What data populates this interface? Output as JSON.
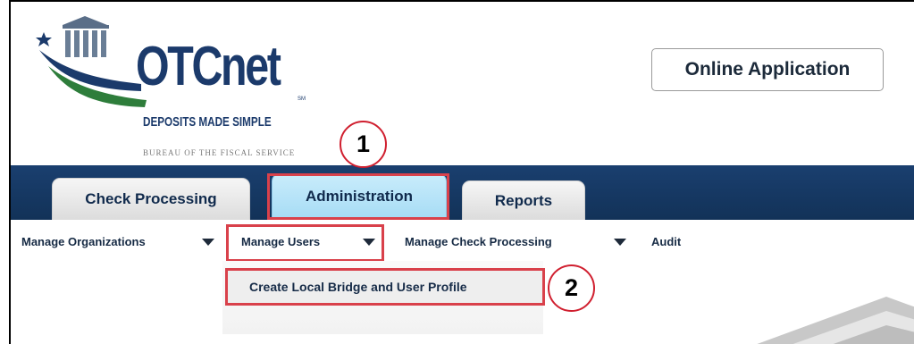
{
  "logo": {
    "name": "OTCnet",
    "sm_mark": "SM",
    "tagline": "DEPOSITS MADE SIMPLE",
    "bureau": "BUREAU OF THE FISCAL SERVICE"
  },
  "header": {
    "online_application_label": "Online Application"
  },
  "callouts": {
    "one": "1",
    "two": "2"
  },
  "tabs": [
    {
      "label": "Check Processing"
    },
    {
      "label": "Administration"
    },
    {
      "label": "Reports"
    }
  ],
  "submenu": {
    "items": [
      {
        "label": "Manage Organizations"
      },
      {
        "label": "Manage Users"
      },
      {
        "label": "Manage Check Processing"
      },
      {
        "label": "Audit"
      }
    ]
  },
  "dropdown": {
    "items": [
      {
        "label": "Create Local Bridge and User Profile"
      }
    ]
  },
  "colors": {
    "navbar": "#1a3f6f",
    "highlight": "#d9414b",
    "active_tab": "#a6dcf5",
    "logo_navy": "#1b3a6b",
    "logo_green": "#2e7d3b"
  }
}
